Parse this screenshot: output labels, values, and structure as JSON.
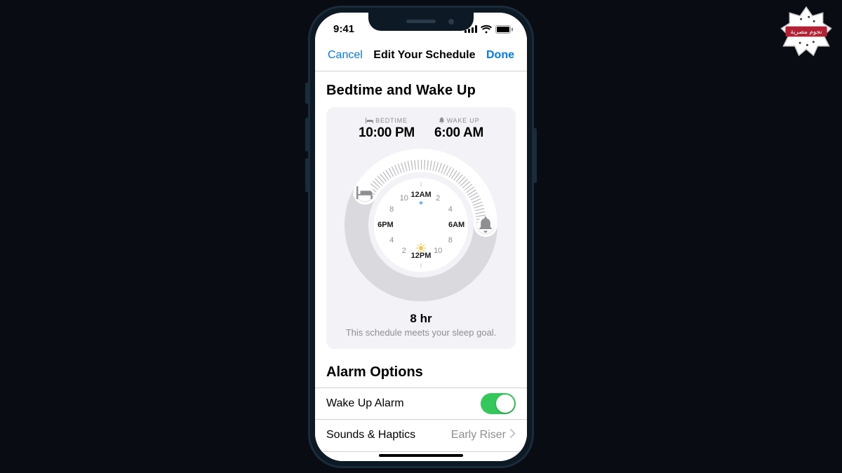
{
  "statusbar": {
    "time": "9:41"
  },
  "navbar": {
    "cancel": "Cancel",
    "title": "Edit Your Schedule",
    "done": "Done"
  },
  "section1": {
    "title": "Bedtime and Wake Up",
    "bedtime_label": "BEDTIME",
    "bedtime_value": "10:00 PM",
    "wake_label": "WAKE UP",
    "wake_value": "6:00 AM",
    "dial": {
      "top": "12AM",
      "right": "6AM",
      "bottom": "12PM",
      "left": "6PM",
      "t2a": "2",
      "t4a": "4",
      "t8a": "8",
      "t10a": "10",
      "t2p": "2",
      "t4p": "4",
      "t8p": "8",
      "t10p": "10"
    },
    "duration": "8 hr",
    "goal_msg": "This schedule meets your sleep goal."
  },
  "section2": {
    "title": "Alarm Options",
    "row1_label": "Wake Up Alarm",
    "row1_on": true,
    "row2_label": "Sounds & Haptics",
    "row2_value": "Early Riser"
  },
  "watermark": {
    "text": "نجوم مصرية"
  }
}
